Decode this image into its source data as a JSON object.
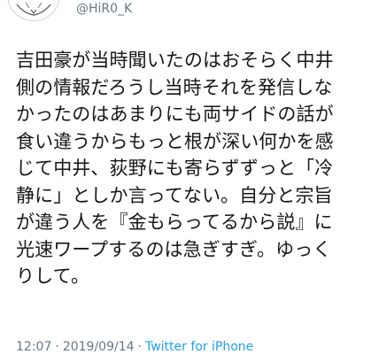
{
  "tweet": {
    "handle": "@HiR0_K",
    "text_lines": [
      "吉田豪が当時聞いたのはおそらく中井",
      "側の情報だろうし当時それを発信しな",
      "かったのはあまりにも両サイドの話が",
      "食い違うからもっと根が深い何かを感",
      "じて中井、荻野にも寄らずずっと「冷",
      "静に」としか言ってない。自分と宗旨",
      "が違う人を『金もらってるから説』に",
      "光速ワープするのは急ぎすぎ。ゆっく",
      "りして。"
    ],
    "time": "12:07",
    "separator": "·",
    "date": "2019/09/14",
    "source": "Twitter for iPhone"
  },
  "colors": {
    "text": "#14171a",
    "secondary": "#657786",
    "link": "#1da1f2",
    "background": "#ffffff"
  },
  "icons": {
    "avatar": "user-avatar"
  }
}
